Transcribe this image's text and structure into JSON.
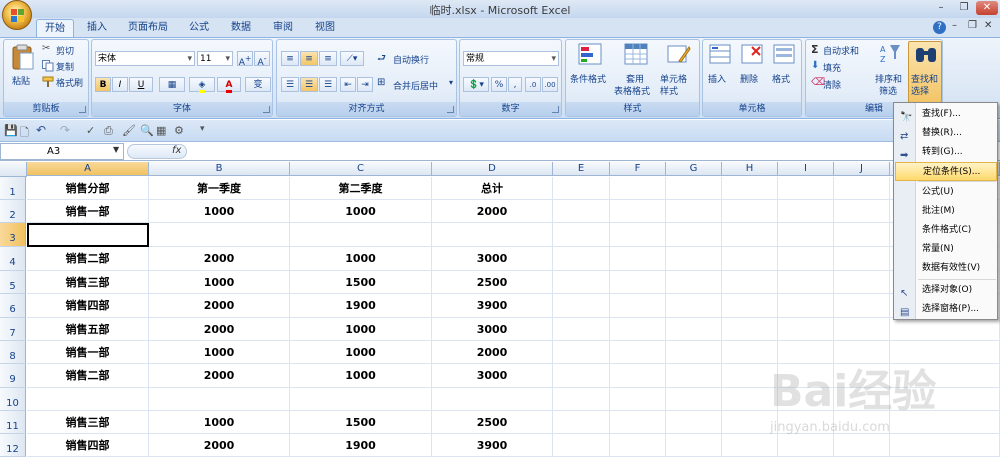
{
  "window": {
    "title": "临时.xlsx - Microsoft Excel",
    "controls": [
      "minimize",
      "restore",
      "close"
    ]
  },
  "tabs": [
    {
      "label": "开始",
      "active": true
    },
    {
      "label": "插入"
    },
    {
      "label": "页面布局"
    },
    {
      "label": "公式"
    },
    {
      "label": "数据"
    },
    {
      "label": "审阅"
    },
    {
      "label": "视图"
    }
  ],
  "ribbon": {
    "clipboard": {
      "label": "剪贴板",
      "paste": "粘贴",
      "cut": "剪切",
      "copy": "复制",
      "format_painter": "格式刷"
    },
    "font": {
      "label": "字体",
      "font_name": "宋体",
      "font_size": "11",
      "bold": "B",
      "italic": "I",
      "underline": "U"
    },
    "alignment": {
      "label": "对齐方式",
      "wrap_text": "自动换行",
      "merge_center": "合并后居中"
    },
    "number": {
      "label": "数字",
      "format": "常规",
      "percent": "%",
      "comma": ","
    },
    "styles": {
      "label": "样式",
      "conditional": "条件格式",
      "table_format_1": "套用",
      "table_format_2": "表格格式",
      "cell_styles_1": "单元格",
      "cell_styles_2": "样式"
    },
    "cells": {
      "label": "单元格",
      "insert": "插入",
      "delete": "删除",
      "format": "格式"
    },
    "editing": {
      "label": "编辑",
      "autosum": "自动求和",
      "fill": "填充",
      "clear": "清除",
      "sort_filter_1": "排序和",
      "sort_filter_2": "筛选",
      "find_select_1": "查找和",
      "find_select_2": "选择"
    }
  },
  "formula_bar": {
    "name_box": "A3",
    "fx": "fx",
    "value": ""
  },
  "grid": {
    "columns": [
      "A",
      "B",
      "C",
      "D",
      "E",
      "F",
      "G",
      "H",
      "I",
      "J"
    ],
    "selected_column": "A",
    "selected_row": "3",
    "rows": [
      {
        "n": "1",
        "cells": [
          "销售分部",
          "第一季度",
          "第二季度",
          "总计"
        ]
      },
      {
        "n": "2",
        "cells": [
          "销售一部",
          "1000",
          "1000",
          "2000"
        ]
      },
      {
        "n": "3",
        "cells": [
          "",
          "",
          "",
          ""
        ]
      },
      {
        "n": "4",
        "cells": [
          "销售二部",
          "2000",
          "1000",
          "3000"
        ]
      },
      {
        "n": "5",
        "cells": [
          "销售三部",
          "1000",
          "1500",
          "2500"
        ]
      },
      {
        "n": "6",
        "cells": [
          "销售四部",
          "2000",
          "1900",
          "3900"
        ]
      },
      {
        "n": "7",
        "cells": [
          "销售五部",
          "2000",
          "1000",
          "3000"
        ]
      },
      {
        "n": "8",
        "cells": [
          "销售一部",
          "1000",
          "1000",
          "2000"
        ]
      },
      {
        "n": "9",
        "cells": [
          "销售二部",
          "2000",
          "1000",
          "3000"
        ]
      },
      {
        "n": "10",
        "cells": [
          "",
          "",
          "",
          ""
        ]
      },
      {
        "n": "11",
        "cells": [
          "销售三部",
          "1000",
          "1500",
          "2500"
        ]
      },
      {
        "n": "12",
        "cells": [
          "销售四部",
          "2000",
          "1900",
          "3900"
        ]
      }
    ]
  },
  "find_select_menu": {
    "items": [
      {
        "label": "查找(F)...",
        "icon": "binoculars-icon"
      },
      {
        "label": "替换(R)...",
        "icon": "replace-icon"
      },
      {
        "label": "转到(G)...",
        "icon": "arrow-right-icon"
      },
      {
        "label": "定位条件(S)...",
        "icon": "none",
        "highlighted": true
      },
      {
        "label": "公式(U)"
      },
      {
        "label": "批注(M)"
      },
      {
        "label": "条件格式(C)"
      },
      {
        "label": "常量(N)"
      },
      {
        "label": "数据有效性(V)"
      },
      {
        "label": "选择对象(O)",
        "icon": "pointer-icon"
      },
      {
        "label": "选择窗格(P)...",
        "icon": "selection-pane-icon"
      }
    ]
  },
  "watermark": {
    "logo": "Bai经验",
    "url": "jingyan.baidu.com"
  }
}
